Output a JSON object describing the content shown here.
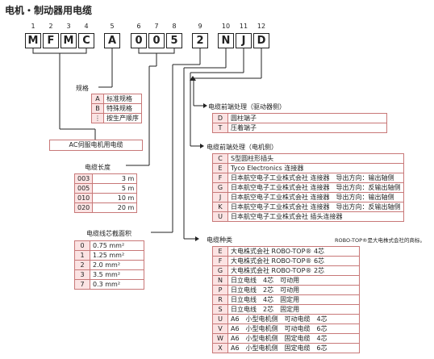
{
  "title": "电机・制动器用电缆",
  "positions": [
    "1",
    "2",
    "3",
    "4",
    "5",
    "6",
    "7",
    "8",
    "9",
    "10",
    "11",
    "12"
  ],
  "code": [
    "M",
    "F",
    "M",
    "C",
    "A",
    "0",
    "0",
    "5",
    "2",
    "N",
    "J",
    "D"
  ],
  "spec": {
    "label": "规格",
    "rows": [
      {
        "k": "A",
        "v": "标准规格"
      },
      {
        "k": "B",
        "v": "特殊规格"
      },
      {
        "k": "⋮",
        "v": "按生产顺序"
      }
    ]
  },
  "ac_label": "AC伺服电机用电缆",
  "length": {
    "label": "电缆长度",
    "rows": [
      {
        "k": "003",
        "v": "3 m"
      },
      {
        "k": "005",
        "v": "5 m"
      },
      {
        "k": "010",
        "v": "10 m"
      },
      {
        "k": "020",
        "v": "20 m"
      }
    ]
  },
  "core": {
    "label": "电缆线芯截面积",
    "rows": [
      {
        "k": "0",
        "v": "0.75 mm²"
      },
      {
        "k": "1",
        "v": "1.25 mm²"
      },
      {
        "k": "2",
        "v": "2.0 mm²"
      },
      {
        "k": "3",
        "v": "3.5 mm²"
      },
      {
        "k": "7",
        "v": "0.3 mm²"
      }
    ]
  },
  "driver_end": {
    "label": "电缆前端处理（驱动器侧）",
    "rows": [
      {
        "k": "D",
        "v": "圆柱端子"
      },
      {
        "k": "T",
        "v": "压着端子"
      }
    ]
  },
  "motor_end": {
    "label": "电缆前端处理（电机侧）",
    "rows": [
      {
        "k": "C",
        "v": "S型圆柱形插头"
      },
      {
        "k": "E",
        "v": "Tyco Electronics 连接器"
      },
      {
        "k": "F",
        "v": "日本航空电子工业株式会社 连接器　导出方向：输出轴侧"
      },
      {
        "k": "G",
        "v": "日本航空电子工业株式会社 连接器　导出方向：反输出轴侧"
      },
      {
        "k": "J",
        "v": "日本航空电子工业株式会社 连接器　导出方向：输出轴侧"
      },
      {
        "k": "K",
        "v": "日本航空电子工业株式会社 连接器　导出方向：反输出轴侧"
      },
      {
        "k": "U",
        "v": "日本航空电子工业株式会社 插头连接器"
      }
    ]
  },
  "cable_type": {
    "label": "电缆种类",
    "note": "ROBO-TOP®是大电株式会社的商标。",
    "rows": [
      {
        "k": "E",
        "v": "大电株式会社 ROBO-TOP® 4芯"
      },
      {
        "k": "F",
        "v": "大电株式会社 ROBO-TOP® 6芯"
      },
      {
        "k": "G",
        "v": "大电株式会社 ROBO-TOP® 2芯"
      },
      {
        "k": "N",
        "v": "日立电线　4芯　可动用"
      },
      {
        "k": "P",
        "v": "日立电线　2芯　可动用"
      },
      {
        "k": "R",
        "v": "日立电线　4芯　固定用"
      },
      {
        "k": "S",
        "v": "日立电线　2芯　固定用"
      },
      {
        "k": "U",
        "v": "A6　小型电机侧　可动电缆　4芯"
      },
      {
        "k": "V",
        "v": "A6　小型电机侧　可动电缆　6芯"
      },
      {
        "k": "W",
        "v": "A6　小型电机侧　固定电缆　4芯"
      },
      {
        "k": "X",
        "v": "A6　小型电机侧　固定电缆　6芯"
      }
    ]
  }
}
